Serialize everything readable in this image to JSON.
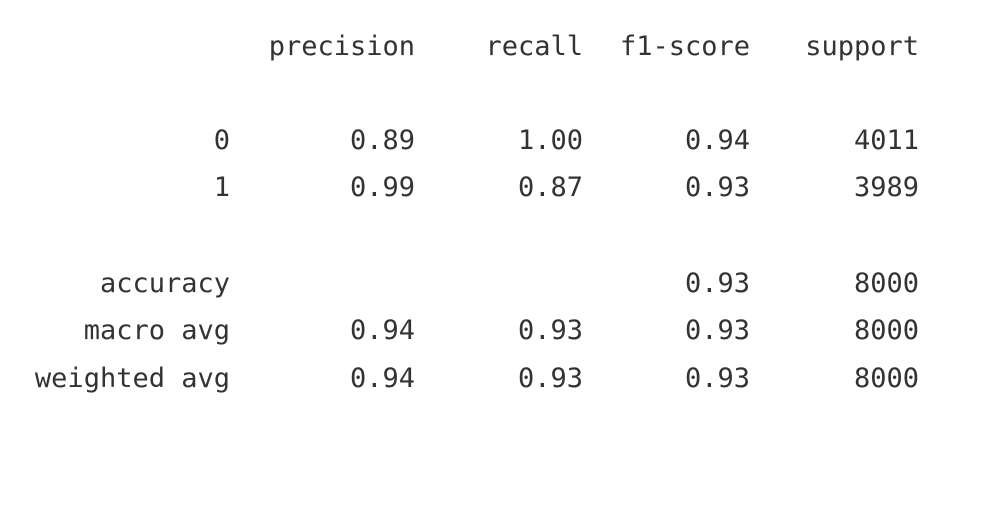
{
  "report": {
    "headers": [
      "precision",
      "recall",
      "f1-score",
      "support"
    ],
    "rows": [
      {
        "label": "0",
        "precision": "0.89",
        "recall": "1.00",
        "f1": "0.94",
        "support": "4011"
      },
      {
        "label": "1",
        "precision": "0.99",
        "recall": "0.87",
        "f1": "0.93",
        "support": "3989"
      },
      {
        "label": "accuracy",
        "precision": "",
        "recall": "",
        "f1": "0.93",
        "support": "8000"
      },
      {
        "label": "macro avg",
        "precision": "0.94",
        "recall": "0.93",
        "f1": "0.93",
        "support": "8000"
      },
      {
        "label": "weighted avg",
        "precision": "0.94",
        "recall": "0.93",
        "f1": "0.93",
        "support": "8000"
      }
    ]
  }
}
